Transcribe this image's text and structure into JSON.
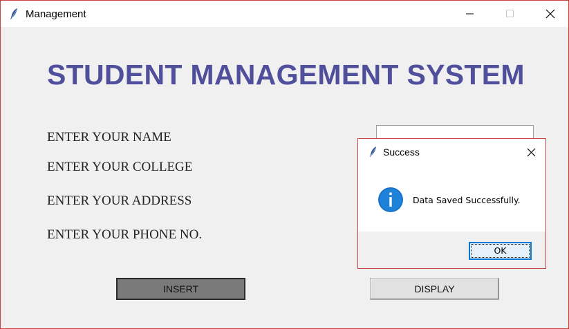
{
  "window": {
    "title": "Management",
    "icon": "feather-icon"
  },
  "form": {
    "heading": "STUDENT MANAGEMENT SYSTEM",
    "labels": {
      "name": "ENTER YOUR NAME",
      "college": "ENTER YOUR COLLEGE",
      "address": "ENTER YOUR ADDRESS",
      "phone": "ENTER YOUR PHONE NO."
    },
    "name_value": "",
    "buttons": {
      "insert": "INSERT",
      "display": "DISPLAY"
    }
  },
  "dialog": {
    "title": "Success",
    "icon": "info-icon",
    "message": "Data Saved Successfully.",
    "ok_label": "OK"
  },
  "colors": {
    "heading": "#4f4f9c",
    "accent_border": "#c9423f",
    "focus": "#0078d7",
    "info_icon": "#1a73c8"
  }
}
